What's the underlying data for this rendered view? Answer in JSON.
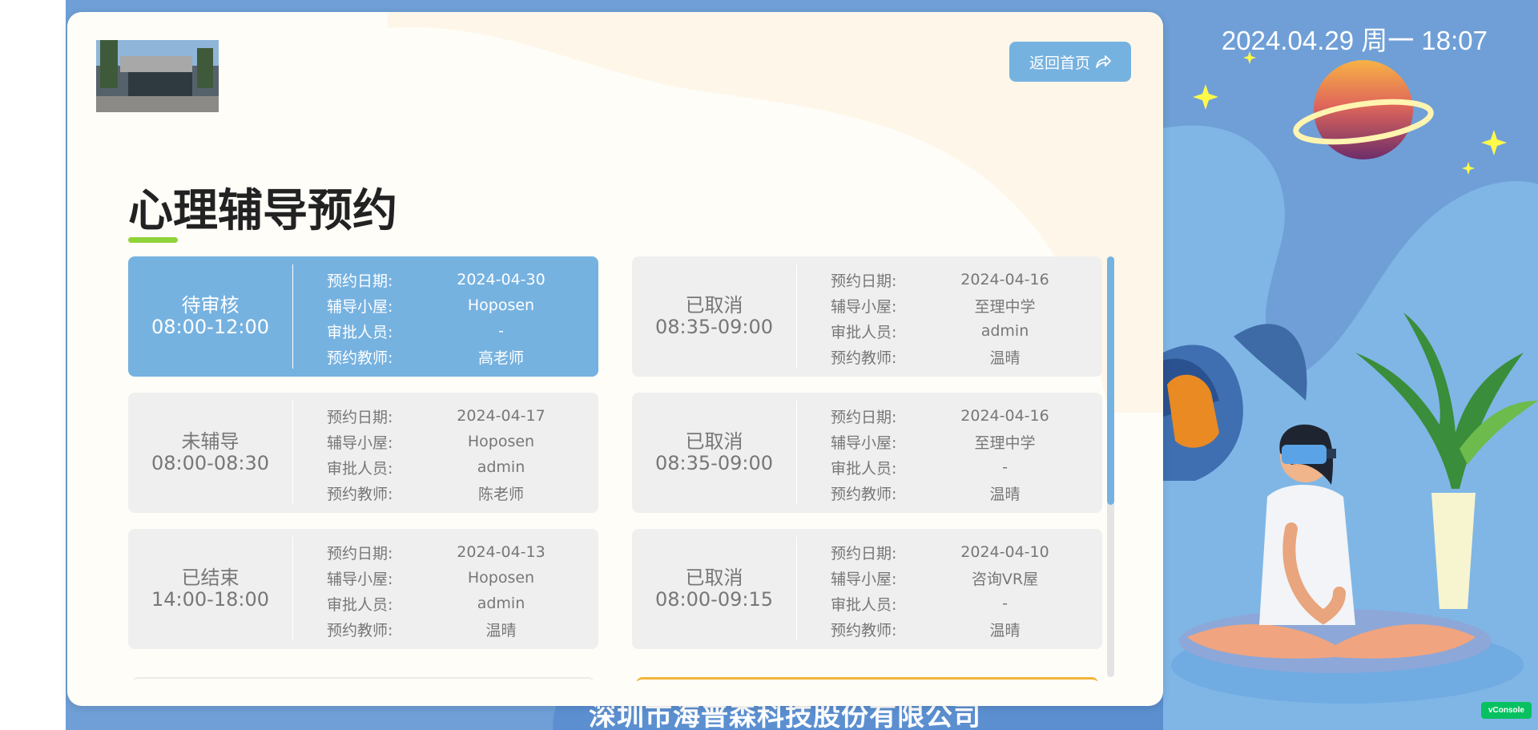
{
  "header": {
    "datetime": "2024.04.29 周一 18:07",
    "home_button_label": "返回首页"
  },
  "page_title": "心理辅导预约",
  "field_labels": {
    "date": "预约日期:",
    "room": "辅导小屋:",
    "approver": "审批人员:",
    "teacher": "预约教师:"
  },
  "appointments": [
    {
      "status": "待审核",
      "time": "08:00-12:00",
      "date": "2024-04-30",
      "room": "Hoposen",
      "approver": "-",
      "teacher": "高老师",
      "active": true
    },
    {
      "status": "已取消",
      "time": "08:35-09:00",
      "date": "2024-04-16",
      "room": "至理中学",
      "approver": "admin",
      "teacher": "温晴"
    },
    {
      "status": "未辅导",
      "time": "08:00-08:30",
      "date": "2024-04-17",
      "room": "Hoposen",
      "approver": "admin",
      "teacher": "陈老师"
    },
    {
      "status": "已取消",
      "time": "08:35-09:00",
      "date": "2024-04-16",
      "room": "至理中学",
      "approver": "-",
      "teacher": "温晴"
    },
    {
      "status": "已结束",
      "time": "14:00-18:00",
      "date": "2024-04-13",
      "room": "Hoposen",
      "approver": "admin",
      "teacher": "温晴"
    },
    {
      "status": "已取消",
      "time": "08:00-09:15",
      "date": "2024-04-10",
      "room": "咨询VR屋",
      "approver": "-",
      "teacher": "温晴"
    }
  ],
  "footer": {
    "company": "深圳市海普森科技股份有限公司"
  },
  "vconsole_label": "vConsole",
  "colors": {
    "accent": "#76b2e0",
    "title_underline": "#8fd338",
    "card_bg": "#efefef",
    "background": "#6f9fd6"
  }
}
